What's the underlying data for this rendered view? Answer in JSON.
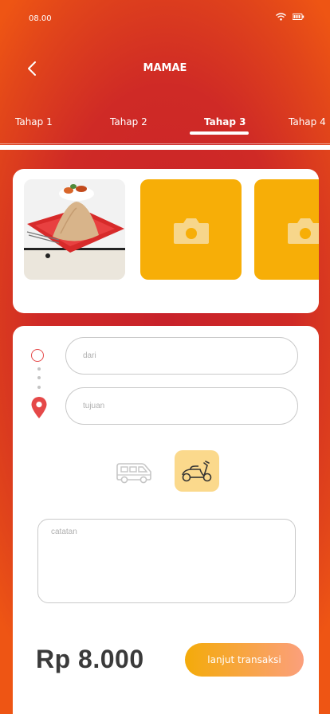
{
  "status": {
    "time": "08.00"
  },
  "header": {
    "title": "MAMAE"
  },
  "tabs": [
    {
      "label": "Tahap 1",
      "active": false
    },
    {
      "label": "Tahap 2",
      "active": false
    },
    {
      "label": "Tahap 3",
      "active": true
    },
    {
      "label": "Tahap 4",
      "active": false
    }
  ],
  "photos": {
    "items": [
      {
        "kind": "food-photo"
      },
      {
        "kind": "add-photo",
        "icon": "camera-icon"
      },
      {
        "kind": "add-photo",
        "icon": "camera-icon"
      }
    ]
  },
  "form": {
    "origin_placeholder": "dari",
    "destination_placeholder": "tujuan",
    "notes_placeholder": "catatan",
    "vehicles": [
      {
        "type": "car",
        "icon": "van-icon",
        "selected": false
      },
      {
        "type": "motorcycle",
        "icon": "scooter-icon",
        "selected": true
      }
    ]
  },
  "footer": {
    "price": "Rp 8.000",
    "cta_label": "lanjut transaksi"
  },
  "colors": {
    "accent": "#c8222a",
    "accent_orange": "#ee5514",
    "photo_placeholder": "#f7ae07",
    "selected_vehicle": "#fbd98c",
    "cta_start": "#f4ab0a",
    "cta_end": "#fb9f7c",
    "pin": "#e54848"
  }
}
